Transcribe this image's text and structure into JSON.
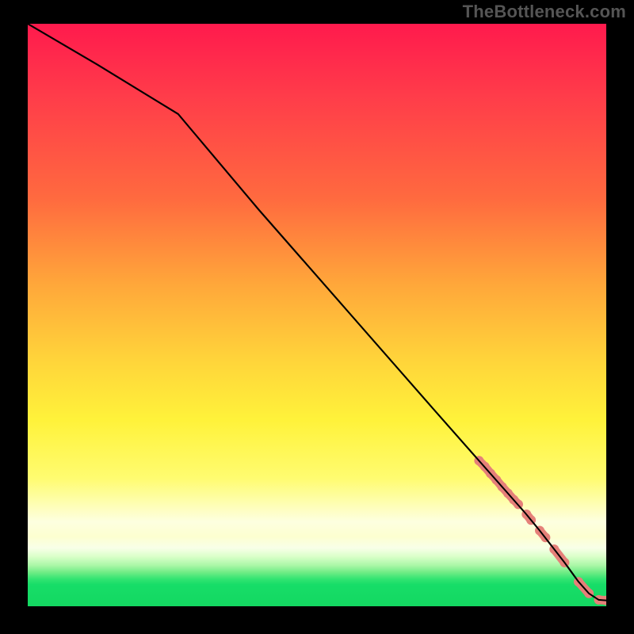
{
  "watermark": "TheBottleneck.com",
  "chart_data": {
    "type": "line",
    "title": "",
    "xlabel": "",
    "ylabel": "",
    "xlim": [
      0,
      100
    ],
    "ylim": [
      0,
      100
    ],
    "grid": false,
    "series": [
      {
        "name": "curve",
        "x": [
          0,
          12,
          26,
          40,
          55,
          70,
          78,
          82,
          86,
          88.5,
          91,
          92.8,
          95.2,
          97,
          98.7,
          100
        ],
        "y": [
          100,
          93,
          84.5,
          68,
          51,
          34,
          25,
          20.5,
          16,
          13,
          9.8,
          7.5,
          4.2,
          2.2,
          1.1,
          1.0
        ]
      }
    ],
    "marker_clusters_x": [
      78,
      79,
      80,
      81,
      82,
      83,
      84,
      84.8,
      86.2,
      87,
      88.5,
      89.5,
      91,
      92.8,
      95.2,
      97,
      98.7,
      100
    ],
    "marker_clusters_y": [
      25,
      24,
      22.8,
      21.7,
      20.5,
      19.4,
      18.3,
      17.5,
      15.8,
      14.8,
      13,
      11.8,
      9.8,
      7.5,
      4.2,
      2.2,
      1.1,
      1.0
    ],
    "colors": {
      "top": "#ff1a4d",
      "mid": "#fff23a",
      "bottom": "#13d861",
      "marker": "#e58079",
      "line": "#000000"
    }
  }
}
